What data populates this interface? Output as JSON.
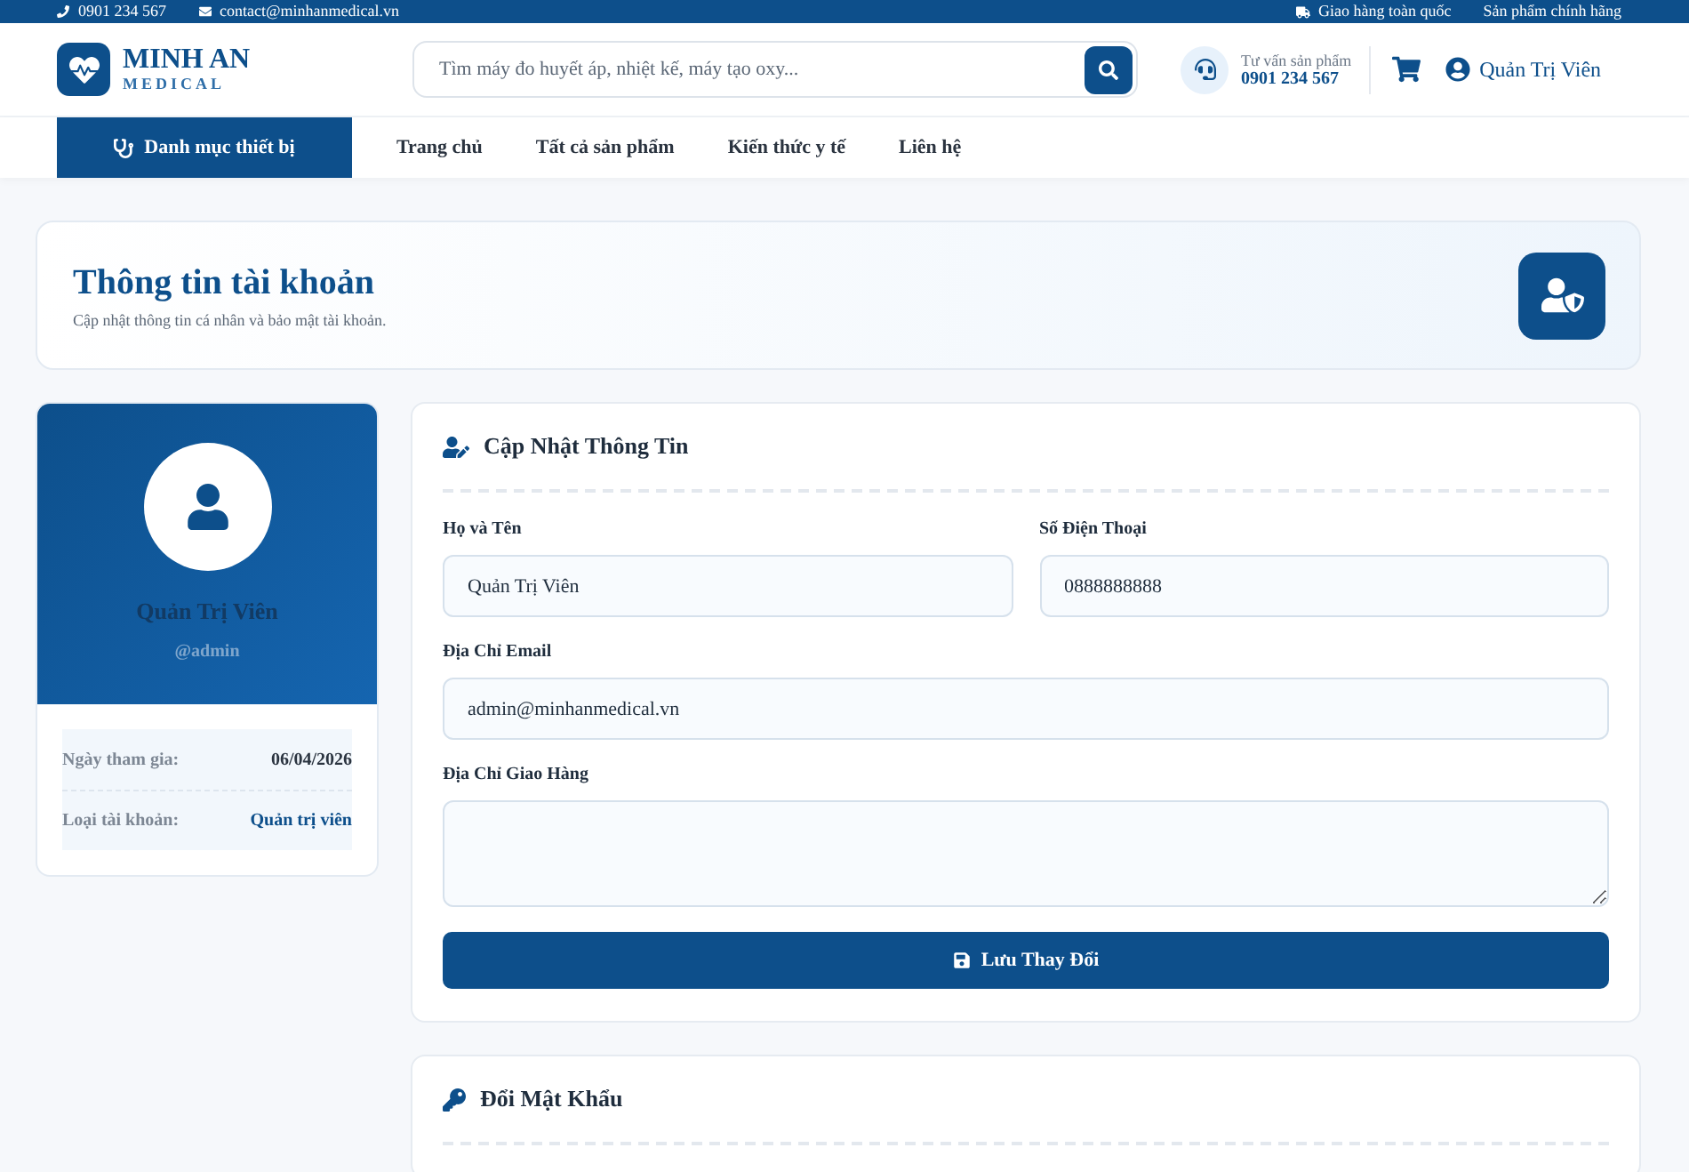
{
  "top_bar": {
    "phone": "0901 234 567",
    "email": "contact@minhanmedical.vn",
    "shipping": "Giao hàng toàn quốc",
    "genuine": "Sản phẩm chính hãng"
  },
  "header": {
    "logo_title": "MINH AN",
    "logo_subtitle": "MEDICAL",
    "search": {
      "placeholder": "Tìm máy đo huyết áp, nhiệt kế, máy tạo oxy..."
    },
    "support_label": "Tư vấn sản phẩm",
    "support_phone": "0901 234 567",
    "user_name": "Quản Trị Viên"
  },
  "nav": {
    "category_button": "Danh mục thiết bị",
    "links": [
      {
        "label": "Trang chủ",
        "selected": false
      },
      {
        "label": "Tất cả sản phẩm",
        "selected": false
      },
      {
        "label": "Kiến thức y tế",
        "selected": false
      },
      {
        "label": "Liên hệ",
        "selected": false
      }
    ]
  },
  "banner": {
    "title": "Thông tin tài khoản",
    "subtitle": "Cập nhật thông tin cá nhân và bảo mật tài khoản."
  },
  "profile": {
    "name": "Quản Trị Viên",
    "username": "@admin",
    "details": [
      {
        "label": "Ngày tham gia:",
        "value": "06/04/2026",
        "kind": "plain"
      },
      {
        "label": "Loại tài khoản:",
        "value": "Quản trị viên",
        "kind": "role"
      }
    ]
  },
  "update_form": {
    "title": "Cập Nhật Thông Tin",
    "fields": [
      {
        "label": "Họ và Tên",
        "value": "Quản Trị Viên",
        "kind": "input"
      },
      {
        "label": "Số Điện Thoại",
        "value": "0888888888",
        "kind": "input"
      },
      {
        "label": "Địa Chỉ Email",
        "value": "admin@minhanmedical.vn",
        "kind": "input"
      },
      {
        "label": "Địa Chỉ Giao Hàng",
        "kind": "textarea"
      }
    ],
    "submit": "Lưu Thay Đổi"
  },
  "password_form": {
    "title": "Đổi Mật Khẩu"
  }
}
